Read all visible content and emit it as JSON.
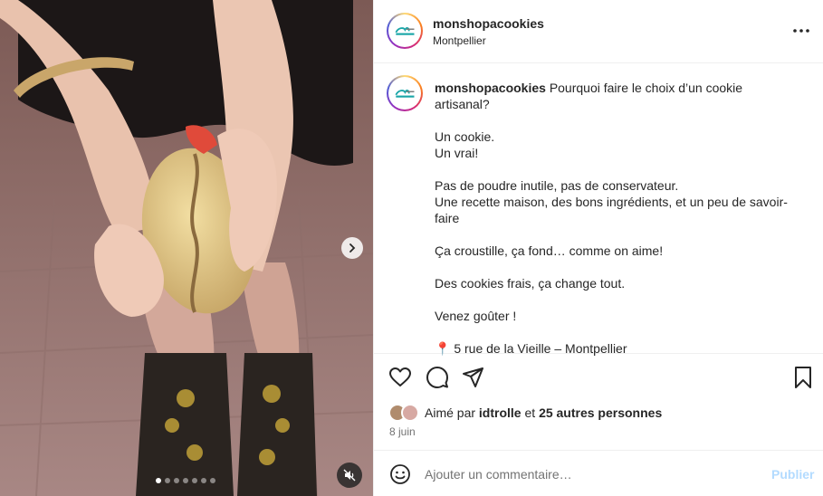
{
  "post": {
    "username": "monshopacookies",
    "location": "Montpellier",
    "caption_first_line": "Pourquoi faire le choix d’un cookie artisanal?",
    "caption_lines": [
      "Un cookie.",
      "Un vrai!",
      "",
      "Pas de poudre inutile, pas de conservateur.",
      "Une recette maison, des bons ingrédients, et un peu de savoir-",
      "faire",
      "",
      "Ça croustille, ça fond… comme on aime!",
      "",
      "Des cookies frais, ça change tout.",
      "",
      "Venez goûter !",
      "",
      "📍 5 rue de la Vieille – Montpellier"
    ],
    "likes_prefix": "Aimé par",
    "likes_user": "idtrolle",
    "likes_joiner": "et",
    "likes_others": "25 autres personnes",
    "date": "8 juin"
  },
  "carousel": {
    "slide_count": 7,
    "active_index": 0
  },
  "comment": {
    "placeholder": "Ajouter un commentaire…",
    "publish_label": "Publier"
  },
  "icons": {
    "more": "more-horizontal-icon",
    "like": "heart-icon",
    "comment": "comment-icon",
    "share": "paper-plane-icon",
    "save": "bookmark-icon",
    "emoji": "smiley-icon",
    "next": "chevron-right-icon",
    "mute": "speaker-muted-icon",
    "location": "pin-icon"
  },
  "colors": {
    "publish_disabled": "#b3dbff",
    "secondary_text": "#737373",
    "brand_teal": "#1aa6a8"
  }
}
